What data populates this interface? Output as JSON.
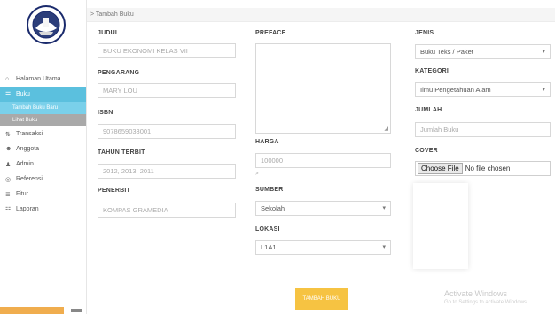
{
  "sidebar": {
    "items": [
      {
        "label": "Halaman Utama",
        "icon": "home-icon",
        "glyph": "⌂"
      },
      {
        "label": "Buku",
        "icon": "book-icon",
        "glyph": "☰"
      },
      {
        "label": "Transaksi",
        "icon": "transaction-icon",
        "glyph": "⇅"
      },
      {
        "label": "Anggota",
        "icon": "members-icon",
        "glyph": "☻"
      },
      {
        "label": "Admin",
        "icon": "user-icon",
        "glyph": "♟"
      },
      {
        "label": "Referensi",
        "icon": "globe-icon",
        "glyph": "◎"
      },
      {
        "label": "Fitur",
        "icon": "list-icon",
        "glyph": "≣"
      },
      {
        "label": "Laporan",
        "icon": "report-icon",
        "glyph": "☷"
      }
    ],
    "subitems": [
      "Tambah Buku Baru",
      "Lihat Buku"
    ]
  },
  "breadcrumb": "> Tambah Buku",
  "form": {
    "judul": {
      "label": "JUDUL",
      "value": "BUKU EKONOMI KELAS VII"
    },
    "pengarang": {
      "label": "PENGARANG",
      "value": "MARY LOU"
    },
    "isbn": {
      "label": "ISBN",
      "value": "9078659033001"
    },
    "tahun": {
      "label": "TAHUN TERBIT",
      "value": "2012, 2013, 2011"
    },
    "penerbit": {
      "label": "PENERBIT",
      "value": "KOMPAS GRAMEDIA"
    },
    "preface": {
      "label": "PREFACE",
      "value": ""
    },
    "harga": {
      "label": "HARGA",
      "value": "100000",
      "hint": ">"
    },
    "sumber": {
      "label": "SUMBER",
      "value": "Sekolah"
    },
    "lokasi": {
      "label": "LOKASI",
      "value": "L1A1"
    },
    "jenis": {
      "label": "JENIS",
      "value": "Buku Teks / Paket"
    },
    "kategori": {
      "label": "KATEGORI",
      "value": "Ilmu Pengetahuan Alam"
    },
    "jumlah": {
      "label": "JUMLAH",
      "placeholder": "Jumlah Buku"
    },
    "cover": {
      "label": "COVER",
      "button": "Choose File",
      "status": "No file chosen"
    }
  },
  "submit_label": "TAMBAH BUKU",
  "watermark": {
    "title": "Activate Windows",
    "subtitle": "Go to Settings to activate Windows."
  },
  "colors": {
    "accent": "#5bc0de",
    "submit": "#f6c342"
  }
}
